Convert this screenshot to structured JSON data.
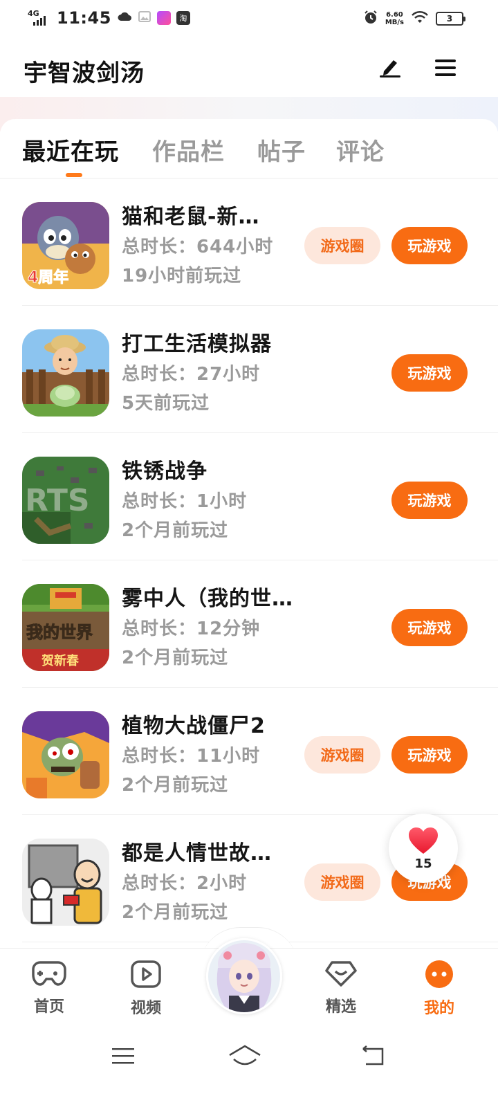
{
  "status_bar": {
    "network": "4G",
    "time": "11:45",
    "app_icon_label": "淘",
    "speed_value": "6.60",
    "speed_unit": "MB/s",
    "battery": "3"
  },
  "header": {
    "title": "宇智波剑汤"
  },
  "tabs": [
    {
      "label": "最近在玩",
      "active": true
    },
    {
      "label": "作品栏",
      "active": false
    },
    {
      "label": "帖子",
      "active": false
    },
    {
      "label": "评论",
      "active": false
    }
  ],
  "games": [
    {
      "name": "猫和老鼠-新…",
      "duration": "总时长：644小时",
      "last_played": "19小时前玩过",
      "circle_label": "游戏圈",
      "play_label": "玩游戏",
      "icon_text": "4周年"
    },
    {
      "name": "打工生活模拟器",
      "duration": "总时长：27小时",
      "last_played": "5天前玩过",
      "play_label": "玩游戏"
    },
    {
      "name": "铁锈战争",
      "duration": "总时长：1小时",
      "last_played": "2个月前玩过",
      "play_label": "玩游戏",
      "icon_text": "RTS"
    },
    {
      "name": "雾中人（我的世界）",
      "duration": "总时长：12分钟",
      "last_played": "2个月前玩过",
      "play_label": "玩游戏",
      "icon_text": "我的世界",
      "icon_text2": "贺新春"
    },
    {
      "name": "植物大战僵尸2",
      "duration": "总时长：11小时",
      "last_played": "2个月前玩过",
      "circle_label": "游戏圈",
      "play_label": "玩游戏"
    },
    {
      "name": "都是人情世故…",
      "duration": "总时长：2小时",
      "last_played": "2个月前玩过",
      "circle_label": "游戏圈",
      "play_label": "玩游戏"
    }
  ],
  "like_float": {
    "count": "15"
  },
  "bottom_nav": [
    {
      "label": "首页",
      "icon": "gamepad-icon"
    },
    {
      "label": "视频",
      "icon": "video-play-icon"
    },
    {
      "label": "精选",
      "icon": "heart-diamond-icon"
    },
    {
      "label": "我的",
      "icon": "smile-dots-icon",
      "active": true
    }
  ],
  "colors": {
    "accent": "#f86c12",
    "accent_soft": "#fde7dc",
    "muted_text": "#9a9a9a"
  }
}
